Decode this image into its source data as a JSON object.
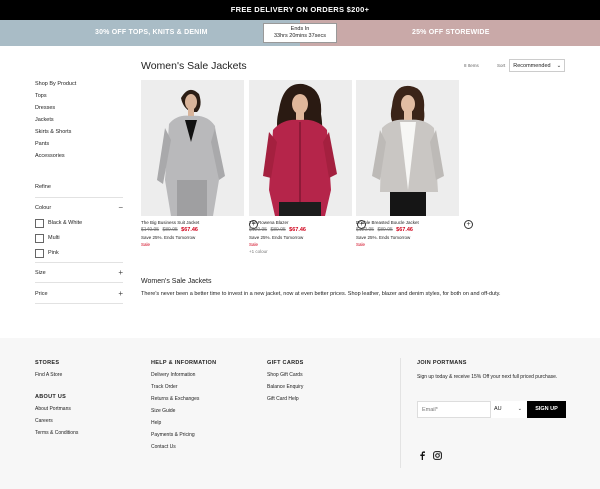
{
  "top_banner": "FREE DELIVERY ON ORDERS $200+",
  "promo": {
    "left": "30% OFF TOPS, KNITS & DENIM",
    "right": "25% OFF STOREWIDE",
    "timer_line1": "Ends In",
    "timer_line2": "33hrs 20mins 37secs"
  },
  "sidebar": {
    "links": [
      "Shop By Product",
      "Tops",
      "Dresses",
      "Jackets",
      "Skirts & Shorts",
      "Pants",
      "Accessories"
    ],
    "refine": "Refine",
    "colour_label": "Colour",
    "colour_options": [
      "Black & White",
      "Multi",
      "Pink"
    ],
    "size_label": "Size",
    "price_label": "Price"
  },
  "page": {
    "heading": "Women's Sale Jackets",
    "item_count": "8 Items",
    "sort_label": "Sort",
    "sort_value": "Recommended"
  },
  "products": [
    {
      "name": "The Big Business Suit Jacket",
      "was1": "$149.95",
      "was2": "$89.95",
      "now": "$67.46",
      "promo": "Save 25%. Ends Tomorrow",
      "sale": "Sale",
      "more": ""
    },
    {
      "name": "The Rowena Blazer",
      "was1": "$129.95",
      "was2": "$89.95",
      "now": "$67.46",
      "promo": "Save 25%. Ends Tomorrow",
      "sale": "Sale",
      "more": "+1 colour"
    },
    {
      "name": "Double Breasted Boucle Jacket",
      "was1": "$129.95",
      "was2": "$89.95",
      "now": "$67.46",
      "promo": "Save 25%. Ends Tomorrow",
      "sale": "Sale",
      "more": ""
    }
  ],
  "description": {
    "title": "Women's Sale Jackets",
    "body": "There's never been a better time to invest in a new jacket, now at even better prices. Shop leather, blazer and denim styles, for both on and off-duty."
  },
  "footer": {
    "stores": {
      "title": "STORES",
      "links": [
        "Find A Store"
      ]
    },
    "about": {
      "title": "ABOUT US",
      "links": [
        "About Portmans",
        "Careers",
        "Terms & Conditions"
      ]
    },
    "help": {
      "title": "HELP & INFORMATION",
      "links": [
        "Delivery Information",
        "Track Order",
        "Returns & Exchanges",
        "Size Guide",
        "Help",
        "Payments & Pricing",
        "Contact Us"
      ]
    },
    "gift": {
      "title": "GIFT CARDS",
      "links": [
        "Shop Gift Cards",
        "Balance Enquiry",
        "Gift Card Help"
      ]
    },
    "join": {
      "title": "JOIN PORTMANS",
      "text": "Sign up today & receive 15% Off your next full priced purchase.",
      "email_placeholder": "Email*",
      "country": "AU",
      "button": "SIGN UP"
    }
  },
  "colors": {
    "promo_left_bg": "#a9bcc6",
    "promo_right_bg": "#c9a9a8",
    "sale_red": "#d0021b"
  },
  "icons": [
    "facebook-icon",
    "instagram-icon",
    "add-circle-icon",
    "plus-icon",
    "minus-icon",
    "chevron-down-icon"
  ]
}
